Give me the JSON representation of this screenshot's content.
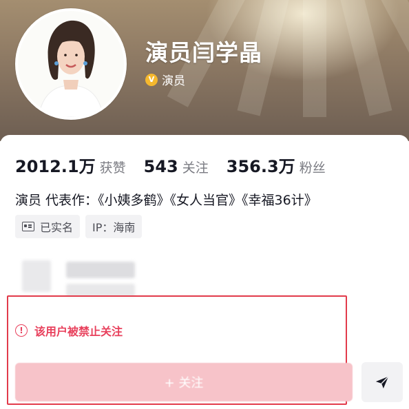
{
  "profile": {
    "name": "演员闫学晶",
    "verify_badge": "V",
    "verify_label": "演员"
  },
  "stats": [
    {
      "number": "2012.1万",
      "label": "获赞"
    },
    {
      "number": "543",
      "label": "关注"
    },
    {
      "number": "356.3万",
      "label": "粉丝"
    }
  ],
  "bio": "演员 代表作：《小姨多鹤》《女人当官》《幸福36计》",
  "tags": {
    "realname": "已实名",
    "ip": "IP：海南"
  },
  "alert": {
    "icon_glyph": "!",
    "text": "该用户被禁止关注"
  },
  "follow_button": {
    "label": "+ 关注"
  },
  "colors": {
    "alert": "#e8405c",
    "highlight_border": "#e23a4a",
    "follow_disabled": "#f7c3c9",
    "verify": "#f5b82e"
  },
  "icons": {
    "verify": "verified-v-icon",
    "realname": "id-card-icon",
    "alert": "exclamation-circle-icon",
    "share": "paper-plane-icon"
  }
}
